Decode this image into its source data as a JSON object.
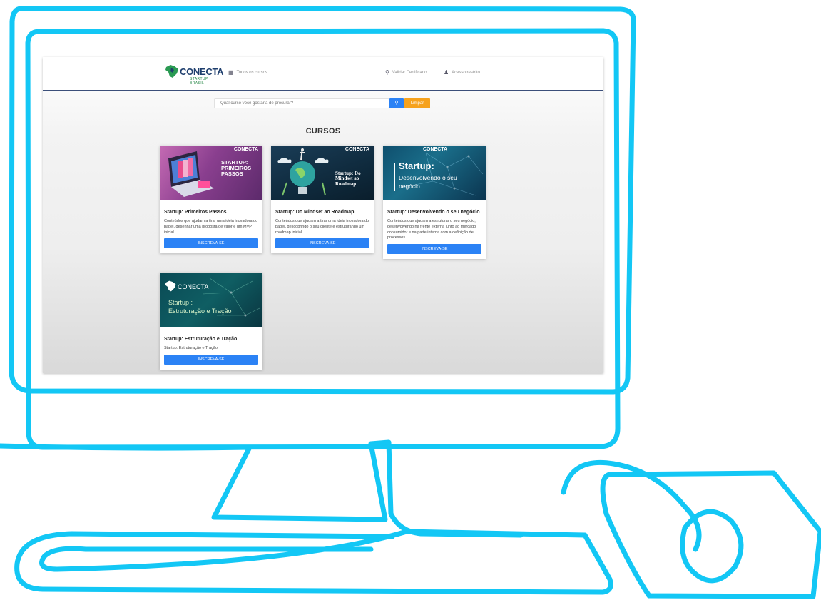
{
  "header": {
    "logo_title": "CONECTA",
    "logo_subtitle": "STARTUP BRASIL",
    "all_courses": "Todos os cursos",
    "validate_certificate": "Validar Certificado",
    "restricted_access": "Acesso restrito"
  },
  "search": {
    "placeholder": "Qual curso você gostaria de procurar?",
    "clear_label": "Limpar"
  },
  "section_title": "CURSOS",
  "courses": [
    {
      "image_title": "STARTUP: PRIMEIROS PASSOS",
      "image_logo": "CONECTA",
      "title": "Startup: Primeiros Passos",
      "description": "Conteúdos que ajudam a tirar uma ideia inovadora do papel, desenhar uma proposta de valor e um MVP inicial.",
      "button": "INSCREVA-SE"
    },
    {
      "image_title": "Startup: Do Mindset ao Roadmap",
      "image_logo": "CONECTA",
      "title": "Startup: Do Mindset ao Roadmap",
      "description": "Conteúdos que ajudam a tirar uma ideia inovadora do papel, descobrindo o seu cliente e estruturando um roadmap inicial.",
      "button": "INSCREVA-SE"
    },
    {
      "image_title": "Startup:",
      "image_subtitle": "Desenvolvendo o seu negócio",
      "image_logo": "CONECTA",
      "title": "Startup: Desenvolvendo o seu negócio",
      "description": "Conteúdos que ajudam a estruturar o seu negócio, desenvolvendo na frente externa junto ao mercado consumidor e na parte interna com a definição de processos.",
      "button": "INSCREVA-SE"
    },
    {
      "image_title": "Startup :",
      "image_subtitle": "Estruturação e Tração",
      "image_logo": "CONECTA",
      "title": "Startup: Estruturação e Tração",
      "description": "Startup: Estruturação e Tração",
      "button": "INSCREVA-SE"
    }
  ],
  "colors": {
    "outline": "#13c7f5",
    "primary_button": "#2b82f5",
    "clear_button": "#f6a21d",
    "nav_border": "#3b4f7a"
  },
  "icons": {
    "all_courses": "grid-icon",
    "validate": "search-icon",
    "access": "user-icon",
    "search_button": "search-icon"
  }
}
